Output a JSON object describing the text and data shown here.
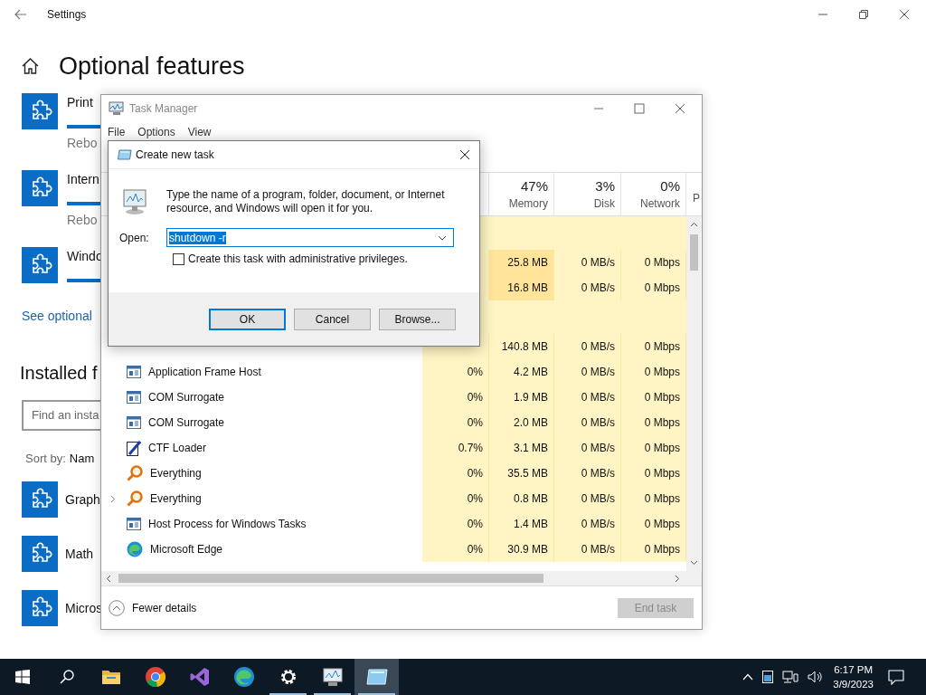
{
  "settings": {
    "title": "Settings",
    "heading": "Optional features",
    "pending_features": [
      {
        "name": "Print",
        "status": "Rebo",
        "level": 1
      },
      {
        "name": "Intern",
        "status": "Rebo",
        "level": 1
      },
      {
        "name": "Windo",
        "level": 1
      }
    ],
    "link": "See optional",
    "installed_heading": "Installed f",
    "search": {
      "placeholder": "Find an insta"
    },
    "sort": {
      "label": "Sort by:",
      "value": "Nam"
    },
    "installed_features": [
      {
        "name": "Graph"
      },
      {
        "name": "Math"
      },
      {
        "name": "Micros"
      }
    ]
  },
  "task_manager": {
    "title": "Task Manager",
    "menu": [
      "File",
      "Options",
      "View"
    ],
    "columns": [
      {
        "usage": "47%",
        "label": "Memory"
      },
      {
        "usage": "3%",
        "label": "Disk"
      },
      {
        "usage": "0%",
        "label": "Network"
      },
      {
        "label": "P"
      }
    ],
    "groups": [
      {
        "rows": [
          {
            "memory": "25.8 MB",
            "disk": "0 MB/s",
            "network": "0 Mbps",
            "memory_high": true
          },
          {
            "memory": "16.8 MB",
            "disk": "0 MB/s",
            "network": "0 Mbps",
            "memory_high": true
          }
        ]
      },
      {
        "rows": [
          {
            "memory": "140.8 MB",
            "disk": "0 MB/s",
            "network": "0 Mbps",
            "memory_high": false,
            "expandable": false
          },
          {
            "name": "Application Frame Host",
            "kind": "window",
            "cpu": "0%",
            "memory": "4.2 MB",
            "disk": "0 MB/s",
            "network": "0 Mbps",
            "memory_high": false,
            "expandable": false
          },
          {
            "name": "COM Surrogate",
            "kind": "window",
            "cpu": "0%",
            "memory": "1.9 MB",
            "disk": "0 MB/s",
            "network": "0 Mbps",
            "memory_high": false,
            "expandable": false
          },
          {
            "name": "COM Surrogate",
            "kind": "window",
            "cpu": "0%",
            "memory": "2.0 MB",
            "disk": "0 MB/s",
            "network": "0 Mbps",
            "memory_high": false,
            "expandable": false
          },
          {
            "name": "CTF Loader",
            "kind": "pen",
            "cpu": "0.7%",
            "memory": "3.1 MB",
            "disk": "0 MB/s",
            "network": "0 Mbps",
            "memory_high": false,
            "expandable": false
          },
          {
            "name": "Everything",
            "kind": "magnifier",
            "cpu": "0%",
            "memory": "35.5 MB",
            "disk": "0 MB/s",
            "network": "0 Mbps",
            "memory_high": false,
            "expandable": false
          },
          {
            "name": "Everything",
            "kind": "magnifier",
            "cpu": "0%",
            "memory": "0.8 MB",
            "disk": "0 MB/s",
            "network": "0 Mbps",
            "memory_high": false,
            "expandable": true
          },
          {
            "name": "Host Process for Windows Tasks",
            "kind": "window",
            "cpu": "0%",
            "memory": "1.4 MB",
            "disk": "0 MB/s",
            "network": "0 Mbps",
            "memory_high": false,
            "expandable": false
          },
          {
            "name": "Microsoft Edge",
            "kind": "edge",
            "cpu": "0%",
            "memory": "30.9 MB",
            "disk": "0 MB/s",
            "network": "0 Mbps",
            "memory_high": false,
            "expandable": false
          }
        ]
      }
    ],
    "footer": {
      "toggle": "Fewer details",
      "end_task": {
        "label": "End task",
        "disabled": true
      }
    }
  },
  "dialog": {
    "title": "Create new task",
    "description": "Type the name of a program, folder, document, or Internet resource, and Windows will open it for you.",
    "open": {
      "label": "Open:",
      "value": "shutdown -r",
      "text_selected": true
    },
    "admin": {
      "label": "Create this task with administrative privileges.",
      "checked": false
    },
    "buttons": [
      {
        "label": "OK",
        "default": true
      },
      {
        "label": "Cancel",
        "default": false
      },
      {
        "label": "Browse...",
        "default": false
      }
    ]
  },
  "taskbar": {
    "apps": [
      {
        "kind": "start",
        "running": false,
        "active": false
      },
      {
        "kind": "search",
        "running": false,
        "active": false
      },
      {
        "kind": "explorer",
        "running": false,
        "active": false
      },
      {
        "kind": "chrome",
        "running": false,
        "active": false
      },
      {
        "kind": "studio",
        "running": false,
        "active": false
      },
      {
        "kind": "edge",
        "running": false,
        "active": false
      },
      {
        "kind": "settings",
        "running": true,
        "active": false
      },
      {
        "kind": "taskmgr",
        "running": true,
        "active": false
      },
      {
        "kind": "run",
        "running": true,
        "active": true
      }
    ],
    "clock": {
      "time": "6:17 PM",
      "date": "3/9/2023"
    }
  }
}
